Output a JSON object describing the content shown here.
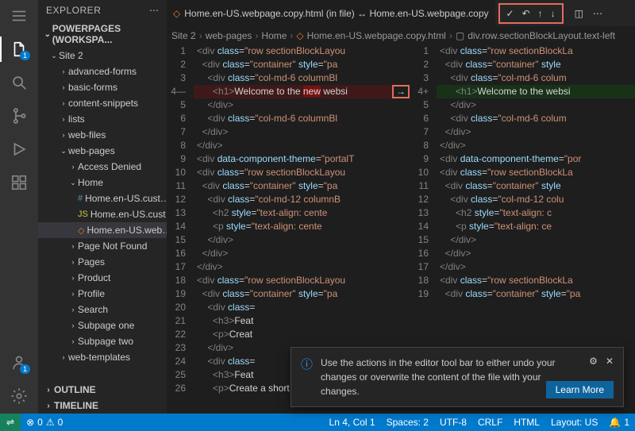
{
  "sidebar": {
    "title": "EXPLORER",
    "workspace": "POWERPAGES (WORKSPA...",
    "tree": [
      {
        "label": "Site 2",
        "depth": 1,
        "chev": "⌄",
        "folder": true
      },
      {
        "label": "advanced-forms",
        "depth": 2,
        "chev": "›",
        "folder": true
      },
      {
        "label": "basic-forms",
        "depth": 2,
        "chev": "›",
        "folder": true
      },
      {
        "label": "content-snippets",
        "depth": 2,
        "chev": "›",
        "folder": true
      },
      {
        "label": "lists",
        "depth": 2,
        "chev": "›",
        "folder": true
      },
      {
        "label": "web-files",
        "depth": 2,
        "chev": "›",
        "folder": true
      },
      {
        "label": "web-pages",
        "depth": 2,
        "chev": "⌄",
        "folder": true
      },
      {
        "label": "Access Denied",
        "depth": 3,
        "chev": "›",
        "folder": true
      },
      {
        "label": "Home",
        "depth": 3,
        "chev": "⌄",
        "folder": true
      },
      {
        "label": "Home.en-US.cust…",
        "depth": 4,
        "icon": "#",
        "iconColor": "#519aba"
      },
      {
        "label": "Home.en-US.cust…",
        "depth": 4,
        "icon": "JS",
        "iconColor": "#cbcb41"
      },
      {
        "label": "Home.en-US.web…",
        "depth": 4,
        "icon": "◇",
        "iconColor": "#e37933",
        "sel": true
      },
      {
        "label": "Page Not Found",
        "depth": 3,
        "chev": "›",
        "folder": true
      },
      {
        "label": "Pages",
        "depth": 3,
        "chev": "›",
        "folder": true
      },
      {
        "label": "Product",
        "depth": 3,
        "chev": "›",
        "folder": true
      },
      {
        "label": "Profile",
        "depth": 3,
        "chev": "›",
        "folder": true
      },
      {
        "label": "Search",
        "depth": 3,
        "chev": "›",
        "folder": true
      },
      {
        "label": "Subpage one",
        "depth": 3,
        "chev": "›",
        "folder": true
      },
      {
        "label": "Subpage two",
        "depth": 3,
        "chev": "›",
        "folder": true
      },
      {
        "label": "web-templates",
        "depth": 2,
        "chev": "›",
        "folder": true
      }
    ],
    "outline": "OUTLINE",
    "timeline": "TIMELINE"
  },
  "tab": {
    "title": "Home.en-US.webpage.copy.html (in file) ↔ Home.en-US.webpage.copy"
  },
  "breadcrumb": {
    "items": [
      "Site 2",
      "web-pages",
      "Home",
      "Home.en-US.webpage.copy.html",
      "div.row.sectionBlockLayout.text-left"
    ]
  },
  "diff": {
    "left": [
      {
        "n": "1",
        "html": "<span class='tk-t'>&lt;div</span> <span class='tk-a'>class</span>=<span class='tk-s'>\"row sectionBlockLayou</span>"
      },
      {
        "n": "2",
        "html": "  <span class='tk-t'>&lt;div</span> <span class='tk-a'>class</span>=<span class='tk-s'>\"container\"</span> <span class='tk-a'>style</span>=<span class='tk-s'>\"pa</span>"
      },
      {
        "n": "3",
        "html": "    <span class='tk-t'>&lt;div</span> <span class='tk-a'>class</span>=<span class='tk-s'>\"col-md-6 columnBl</span>"
      },
      {
        "n": "4—",
        "html": "      <span class='tk-t'>&lt;h1&gt;</span><span class='tk-x'>Welcome to the <span class='hl'>new</span> websi</span>",
        "cls": "del"
      },
      {
        "n": "5",
        "html": "    <span class='tk-t'>&lt;/div&gt;</span>"
      },
      {
        "n": "6",
        "html": "    <span class='tk-t'>&lt;div</span> <span class='tk-a'>class</span>=<span class='tk-s'>\"col-md-6 columnBl</span>"
      },
      {
        "n": "7",
        "html": "  <span class='tk-t'>&lt;/div&gt;</span>"
      },
      {
        "n": "8",
        "html": "<span class='tk-t'>&lt;/div&gt;</span>"
      },
      {
        "n": "9",
        "html": "<span class='tk-t'>&lt;div</span> <span class='tk-a'>data-component-theme</span>=<span class='tk-s'>\"portalT</span>"
      },
      {
        "n": "10",
        "html": "<span class='tk-t'>&lt;div</span> <span class='tk-a'>class</span>=<span class='tk-s'>\"row sectionBlockLayou</span>"
      },
      {
        "n": "11",
        "html": "  <span class='tk-t'>&lt;div</span> <span class='tk-a'>class</span>=<span class='tk-s'>\"container\"</span> <span class='tk-a'>style</span>=<span class='tk-s'>\"pa</span>"
      },
      {
        "n": "12",
        "html": "    <span class='tk-t'>&lt;div</span> <span class='tk-a'>class</span>=<span class='tk-s'>\"col-md-12 columnB</span>"
      },
      {
        "n": "13",
        "html": "      <span class='tk-t'>&lt;h2</span> <span class='tk-a'>style</span>=<span class='tk-s'>\"text-align: cente</span>"
      },
      {
        "n": "14",
        "html": "      <span class='tk-t'>&lt;p</span> <span class='tk-a'>style</span>=<span class='tk-s'>\"text-align: cente</span>"
      },
      {
        "n": "15",
        "html": "    <span class='tk-t'>&lt;/div&gt;</span>"
      },
      {
        "n": "16",
        "html": "  <span class='tk-t'>&lt;/div&gt;</span>"
      },
      {
        "n": "17",
        "html": "<span class='tk-t'>&lt;/div&gt;</span>"
      },
      {
        "n": "18",
        "html": "<span class='tk-t'>&lt;div</span> <span class='tk-a'>class</span>=<span class='tk-s'>\"row sectionBlockLayou</span>"
      },
      {
        "n": "19",
        "html": "  <span class='tk-t'>&lt;div</span> <span class='tk-a'>class</span>=<span class='tk-s'>\"container\"</span> <span class='tk-a'>style</span>=<span class='tk-s'>\"pa</span>"
      },
      {
        "n": "20",
        "html": "    <span class='tk-t'>&lt;div</span> <span class='tk-a'>class</span>="
      },
      {
        "n": "21",
        "html": "      <span class='tk-t'>&lt;h3&gt;</span><span class='tk-x'>Feat</span>"
      },
      {
        "n": "22",
        "html": "      <span class='tk-t'>&lt;p&gt;</span><span class='tk-x'>Creat</span>"
      },
      {
        "n": "23",
        "html": "    <span class='tk-t'>&lt;/div&gt;</span>"
      },
      {
        "n": "24",
        "html": "    <span class='tk-t'>&lt;div</span> <span class='tk-a'>class</span>="
      },
      {
        "n": "25",
        "html": "      <span class='tk-t'>&lt;h3&gt;</span><span class='tk-x'>Feat</span>"
      },
      {
        "n": "26",
        "html": "      <span class='tk-t'>&lt;p&gt;</span><span class='tk-x'>Create a short descripti</span>"
      }
    ],
    "right": [
      {
        "n": "1",
        "html": "<span class='tk-t'>&lt;div</span> <span class='tk-a'>class</span>=<span class='tk-s'>\"row sectionBlockLa</span>"
      },
      {
        "n": "2",
        "html": "  <span class='tk-t'>&lt;div</span> <span class='tk-a'>class</span>=<span class='tk-s'>\"container\"</span> <span class='tk-a'>style</span>"
      },
      {
        "n": "3",
        "html": "    <span class='tk-t'>&lt;div</span> <span class='tk-a'>class</span>=<span class='tk-s'>\"col-md-6 colum</span>"
      },
      {
        "n": "4+",
        "html": "      <span class='tk-t'>&lt;h1&gt;</span><span class='tk-x'>Welcome to the websi</span>",
        "cls": "add"
      },
      {
        "n": "5",
        "html": "    <span class='tk-t'>&lt;/div&gt;</span>"
      },
      {
        "n": "6",
        "html": "    <span class='tk-t'>&lt;div</span> <span class='tk-a'>class</span>=<span class='tk-s'>\"col-md-6 colum</span>"
      },
      {
        "n": "7",
        "html": "  <span class='tk-t'>&lt;/div&gt;</span>"
      },
      {
        "n": "8",
        "html": "<span class='tk-t'>&lt;/div&gt;</span>"
      },
      {
        "n": "9",
        "html": "<span class='tk-t'>&lt;div</span> <span class='tk-a'>data-component-theme</span>=<span class='tk-s'>\"por</span>"
      },
      {
        "n": "10",
        "html": "<span class='tk-t'>&lt;div</span> <span class='tk-a'>class</span>=<span class='tk-s'>\"row sectionBlockLa</span>"
      },
      {
        "n": "11",
        "html": "  <span class='tk-t'>&lt;div</span> <span class='tk-a'>class</span>=<span class='tk-s'>\"container\"</span> <span class='tk-a'>style</span>"
      },
      {
        "n": "12",
        "html": "    <span class='tk-t'>&lt;div</span> <span class='tk-a'>class</span>=<span class='tk-s'>\"col-md-12 colu</span>"
      },
      {
        "n": "13",
        "html": "      <span class='tk-t'>&lt;h2</span> <span class='tk-a'>style</span>=<span class='tk-s'>\"text-align: c</span>"
      },
      {
        "n": "14",
        "html": "      <span class='tk-t'>&lt;p</span> <span class='tk-a'>style</span>=<span class='tk-s'>\"text-align: ce</span>"
      },
      {
        "n": "15",
        "html": "    <span class='tk-t'>&lt;/div&gt;</span>"
      },
      {
        "n": "16",
        "html": "  <span class='tk-t'>&lt;/div&gt;</span>"
      },
      {
        "n": "17",
        "html": "<span class='tk-t'>&lt;/div&gt;</span>"
      },
      {
        "n": "18",
        "html": "<span class='tk-t'>&lt;div</span> <span class='tk-a'>class</span>=<span class='tk-s'>\"row sectionBlockLa</span>"
      },
      {
        "n": "19",
        "html": "  <span class='tk-t'>&lt;div</span> <span class='tk-a'>class</span>=<span class='tk-s'>\"container\"</span> <span class='tk-a'>style</span>=<span class='tk-s'>\"pa</span>"
      },
      {
        "n": "",
        "html": ""
      },
      {
        "n": "",
        "html": ""
      },
      {
        "n": "",
        "html": ""
      },
      {
        "n": "",
        "html": ""
      },
      {
        "n": "",
        "html": ""
      },
      {
        "n": "",
        "html": ""
      },
      {
        "n": "26",
        "html": "      <span class='tk-t'>&lt;p&gt;</span><span class='tk-x'>Create a short descr</span>"
      }
    ]
  },
  "notif": {
    "msg": "Use the actions in the editor tool bar to either undo your changes or overwrite the content of the file with your changes.",
    "btn": "Learn More"
  },
  "status": {
    "errors": "0",
    "warnings": "0",
    "ln": "Ln 4, Col 1",
    "spaces": "Spaces: 2",
    "enc": "UTF-8",
    "eol": "CRLF",
    "lang": "HTML",
    "layout": "Layout: US",
    "bell": "1"
  },
  "badges": {
    "files": "1",
    "account": "1"
  }
}
